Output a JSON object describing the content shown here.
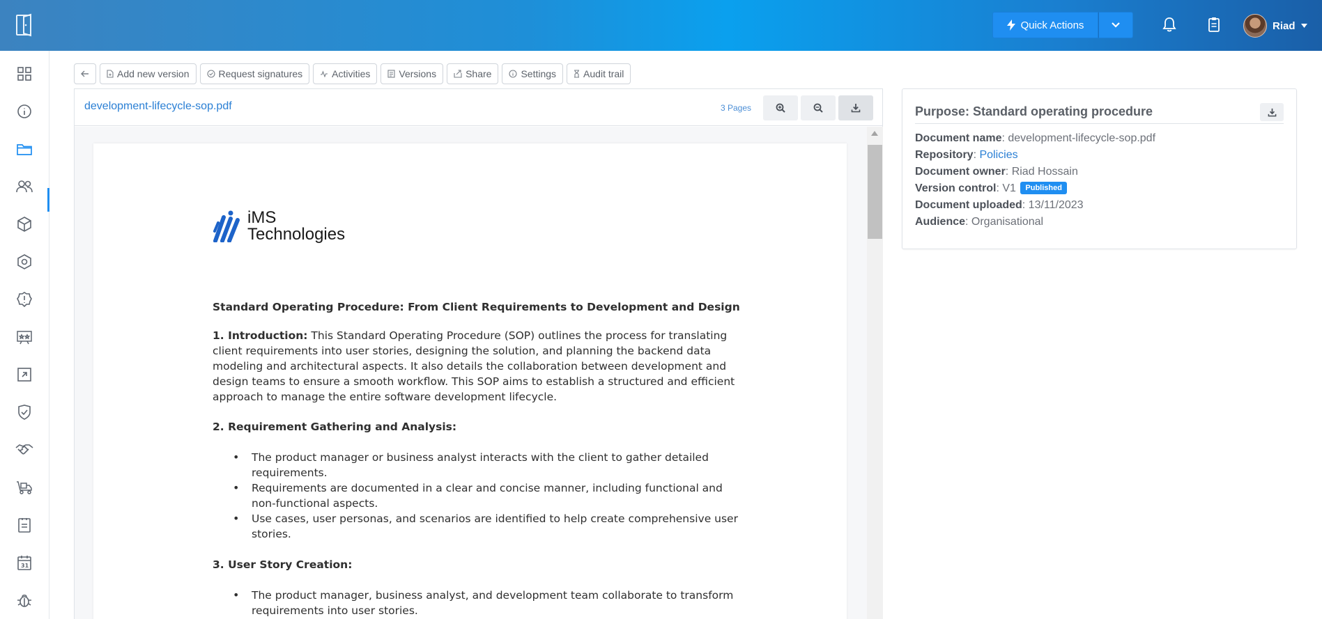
{
  "header": {
    "quick_actions_label": "Quick Actions",
    "user_name": "Riad"
  },
  "sidebar": {
    "items": [
      {
        "icon": "dashboard-grid-icon"
      },
      {
        "icon": "info-icon"
      },
      {
        "icon": "folder-icon",
        "active": true
      },
      {
        "icon": "users-icon"
      },
      {
        "icon": "cube-icon"
      },
      {
        "icon": "hexagon-settings-icon"
      },
      {
        "icon": "alert-badge-icon"
      },
      {
        "icon": "rating-card-icon"
      },
      {
        "icon": "external-link-square-icon"
      },
      {
        "icon": "shield-check-icon"
      },
      {
        "icon": "handshake-icon"
      },
      {
        "icon": "delivery-truck-icon"
      },
      {
        "icon": "clipboard-list-icon"
      },
      {
        "icon": "calendar-31-icon"
      },
      {
        "icon": "bug-icon"
      }
    ]
  },
  "toolbar": {
    "add_version": "Add new version",
    "request_signatures": "Request signatures",
    "activities": "Activities",
    "versions": "Versions",
    "share": "Share",
    "settings": "Settings",
    "audit_trail": "Audit trail"
  },
  "viewer": {
    "filename": "development-lifecycle-sop.pdf",
    "pages": "3 Pages"
  },
  "pdf": {
    "logo_line1": "iMS",
    "logo_line2": "Technologies",
    "title": "Standard Operating Procedure: From Client Requirements to Development and Design",
    "intro_heading": "1. Introduction:",
    "intro_body": " This Standard Operating Procedure (SOP) outlines the process for translating client requirements into user stories, designing the solution, and planning the backend data modeling and architectural aspects. It also details the collaboration between development and design teams to ensure a smooth workflow. This SOP aims to establish a structured and efficient approach to manage the entire software development lifecycle.",
    "section2_heading": "2. Requirement Gathering and Analysis:",
    "section2_items": [
      "The product manager or business analyst interacts with the client to gather detailed requirements.",
      "Requirements are documented in a clear and concise manner, including functional and non-functional aspects.",
      "Use cases, user personas, and scenarios are identified to help create comprehensive user stories."
    ],
    "section3_heading": "3. User Story Creation:",
    "section3_items": [
      "The product manager, business analyst, and development team collaborate to transform requirements into user stories."
    ]
  },
  "info": {
    "title": "Purpose: Standard operating procedure",
    "doc_name_label": "Document name",
    "doc_name": "development-lifecycle-sop.pdf",
    "repository_label": "Repository",
    "repository": "Policies",
    "owner_label": "Document owner",
    "owner": "Riad Hossain",
    "version_label": "Version control",
    "version": "V1",
    "version_status": "Published",
    "uploaded_label": "Document uploaded",
    "uploaded": "13/11/2023",
    "audience_label": "Audience",
    "audience": "Organisational"
  },
  "colors": {
    "accent": "#1f8ef1",
    "link": "#2a7fd4"
  }
}
